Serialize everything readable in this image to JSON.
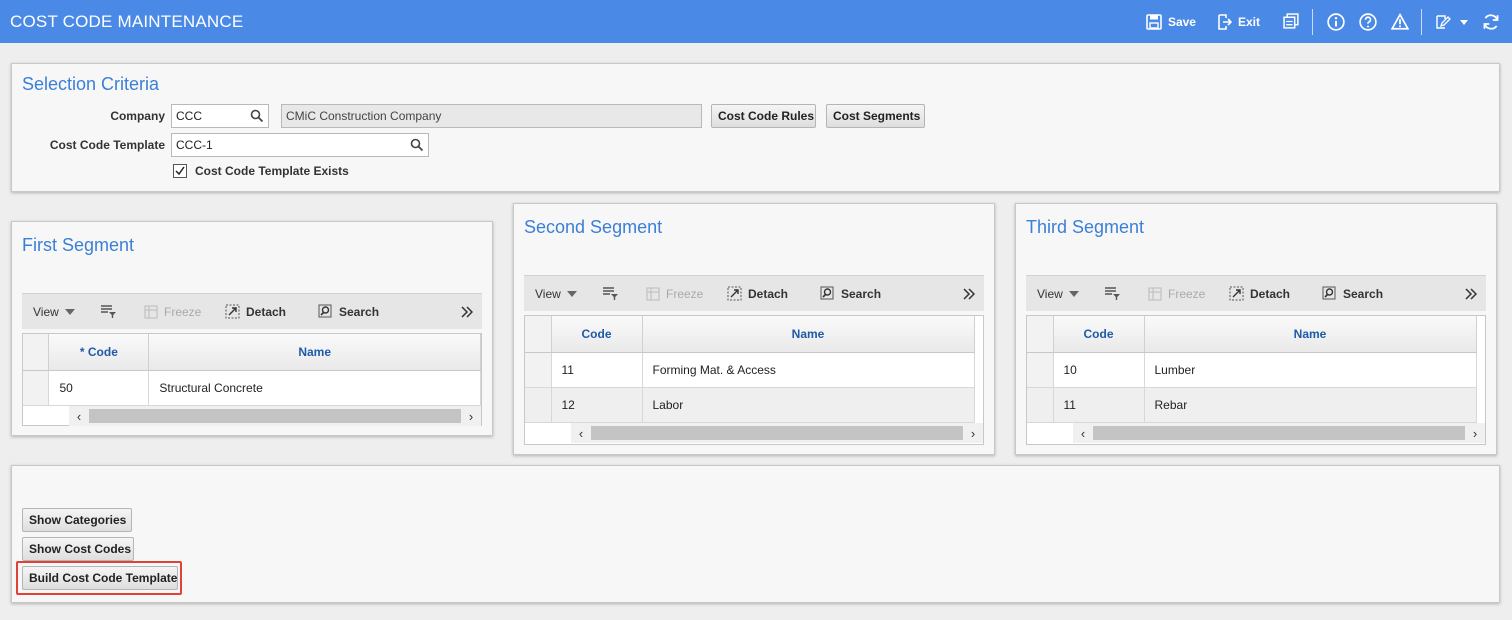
{
  "header": {
    "title": "COST CODE MAINTENANCE",
    "save_label": "Save",
    "exit_label": "Exit"
  },
  "selection": {
    "title": "Selection Criteria",
    "company_label": "Company",
    "company_value": "CCC",
    "company_name": "CMiC Construction Company",
    "template_label": "Cost Code Template",
    "template_value": "CCC-1",
    "exists_label": "Cost Code Template Exists",
    "cost_code_rules_label": "Cost Code Rules",
    "cost_segments_label": "Cost Segments"
  },
  "toolbar": {
    "view": "View",
    "freeze": "Freeze",
    "detach": "Detach",
    "search": "Search"
  },
  "segments": [
    {
      "title": "First Segment",
      "col_code": "* Code",
      "col_name": "Name",
      "rows": [
        {
          "code": "50",
          "name": "Structural Concrete"
        }
      ]
    },
    {
      "title": "Second Segment",
      "col_code": "Code",
      "col_name": "Name",
      "rows": [
        {
          "code": "11",
          "name": "Forming Mat. & Access"
        },
        {
          "code": "12",
          "name": "Labor"
        }
      ]
    },
    {
      "title": "Third Segment",
      "col_code": "Code",
      "col_name": "Name",
      "rows": [
        {
          "code": "10",
          "name": "Lumber"
        },
        {
          "code": "11",
          "name": "Rebar"
        }
      ]
    }
  ],
  "actions": {
    "show_categories": "Show Categories",
    "show_cost_codes": "Show Cost Codes",
    "build_template": "Build Cost Code Template"
  },
  "colors": {
    "header_bg": "#4a8ae6",
    "title_blue": "#3b7fd6",
    "column_header": "#1e5aa8",
    "highlight": "#e2413a"
  }
}
